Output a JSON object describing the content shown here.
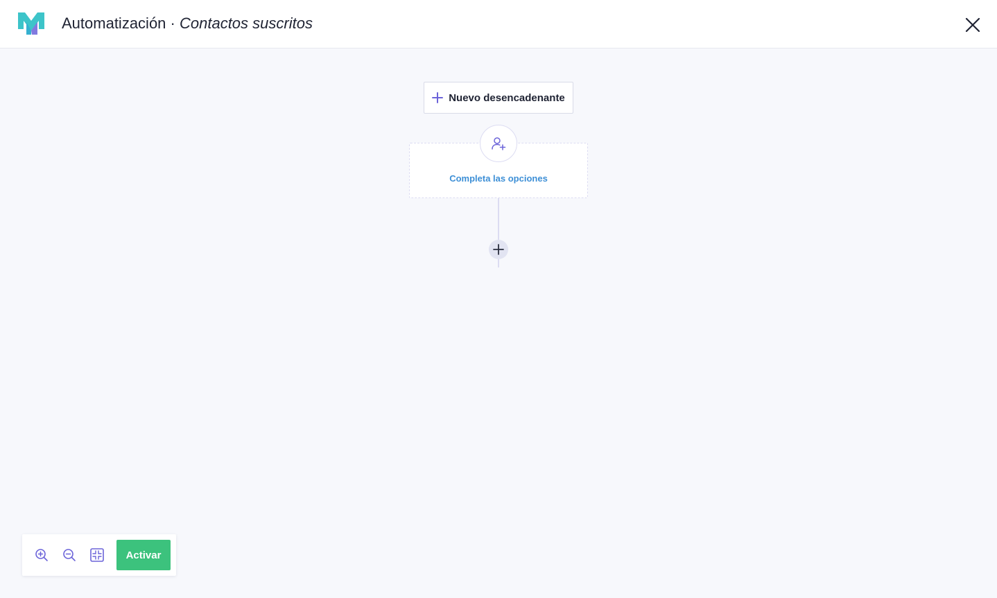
{
  "header": {
    "title": "Automatización",
    "separator": " · ",
    "subtitle": "Contactos suscritos"
  },
  "workflow": {
    "new_trigger_label": "Nuevo desencadenante",
    "node_label": "Completa las opciones",
    "node_icon": "user-plus-icon"
  },
  "toolbar": {
    "zoom_in_icon": "zoom-in-icon",
    "zoom_out_icon": "zoom-out-icon",
    "fit_icon": "fit-screen-icon",
    "activate_label": "Activar"
  },
  "colors": {
    "accent": "#6b63d9",
    "link": "#3d8fd6",
    "activate": "#3cc27d",
    "logo_primary": "#3dc4c9",
    "logo_secondary": "#6b63d9"
  }
}
